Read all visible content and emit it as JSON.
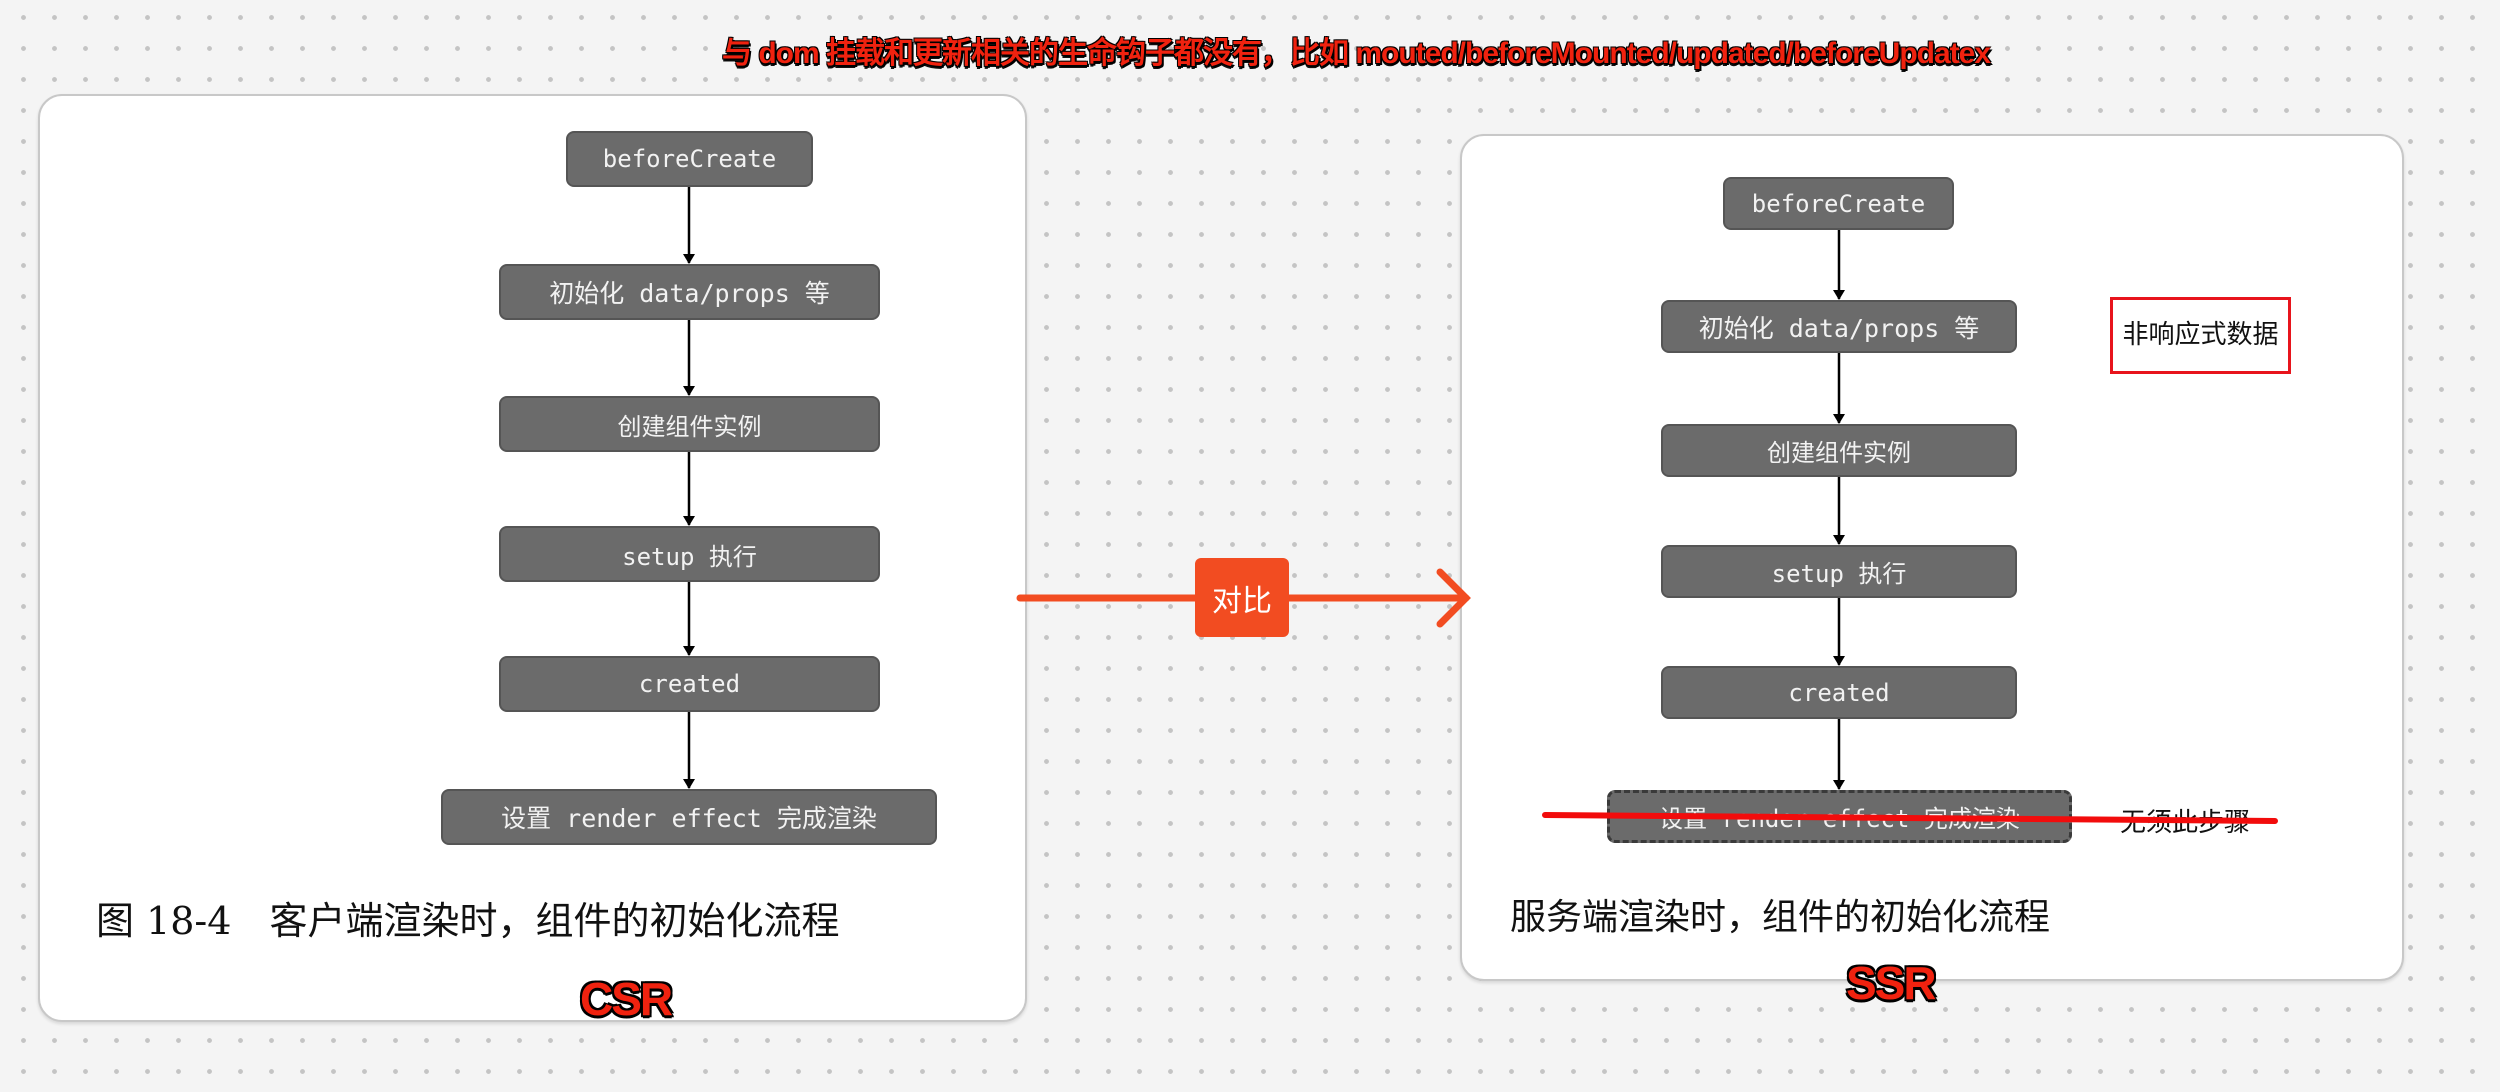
{
  "headline": "与 dom 挂载和更新相关的生命钩子都没有，比如 mouted/beforeMounted/updated/beforeUpdatex",
  "csr": {
    "label": "CSR",
    "caption": "图 18-4　客户端渲染时，组件的初始化流程",
    "steps": [
      {
        "label": "beforeCreate"
      },
      {
        "label": "初始化 data/props 等"
      },
      {
        "label": "创建组件实例"
      },
      {
        "label": "setup 执行"
      },
      {
        "label": "created"
      },
      {
        "label": "设置 render effect 完成渲染"
      }
    ]
  },
  "ssr": {
    "label": "SSR",
    "caption": "服务端渲染时，组件的初始化流程",
    "steps": [
      {
        "label": "beforeCreate"
      },
      {
        "label": "初始化 data/props 等"
      },
      {
        "label": "创建组件实例"
      },
      {
        "label": "setup 执行"
      },
      {
        "label": "created"
      },
      {
        "label": "设置 render effect 完成渲染",
        "struck": true
      }
    ],
    "annotations": {
      "non_reactive": "非响应式数据",
      "no_step": "无须此步骤"
    }
  },
  "compare_label": "对比",
  "colors": {
    "accent": "#f24c21",
    "highlight_red": "#e8141c",
    "node_fill": "#6b6b6b",
    "background": "#f4f4f4"
  }
}
